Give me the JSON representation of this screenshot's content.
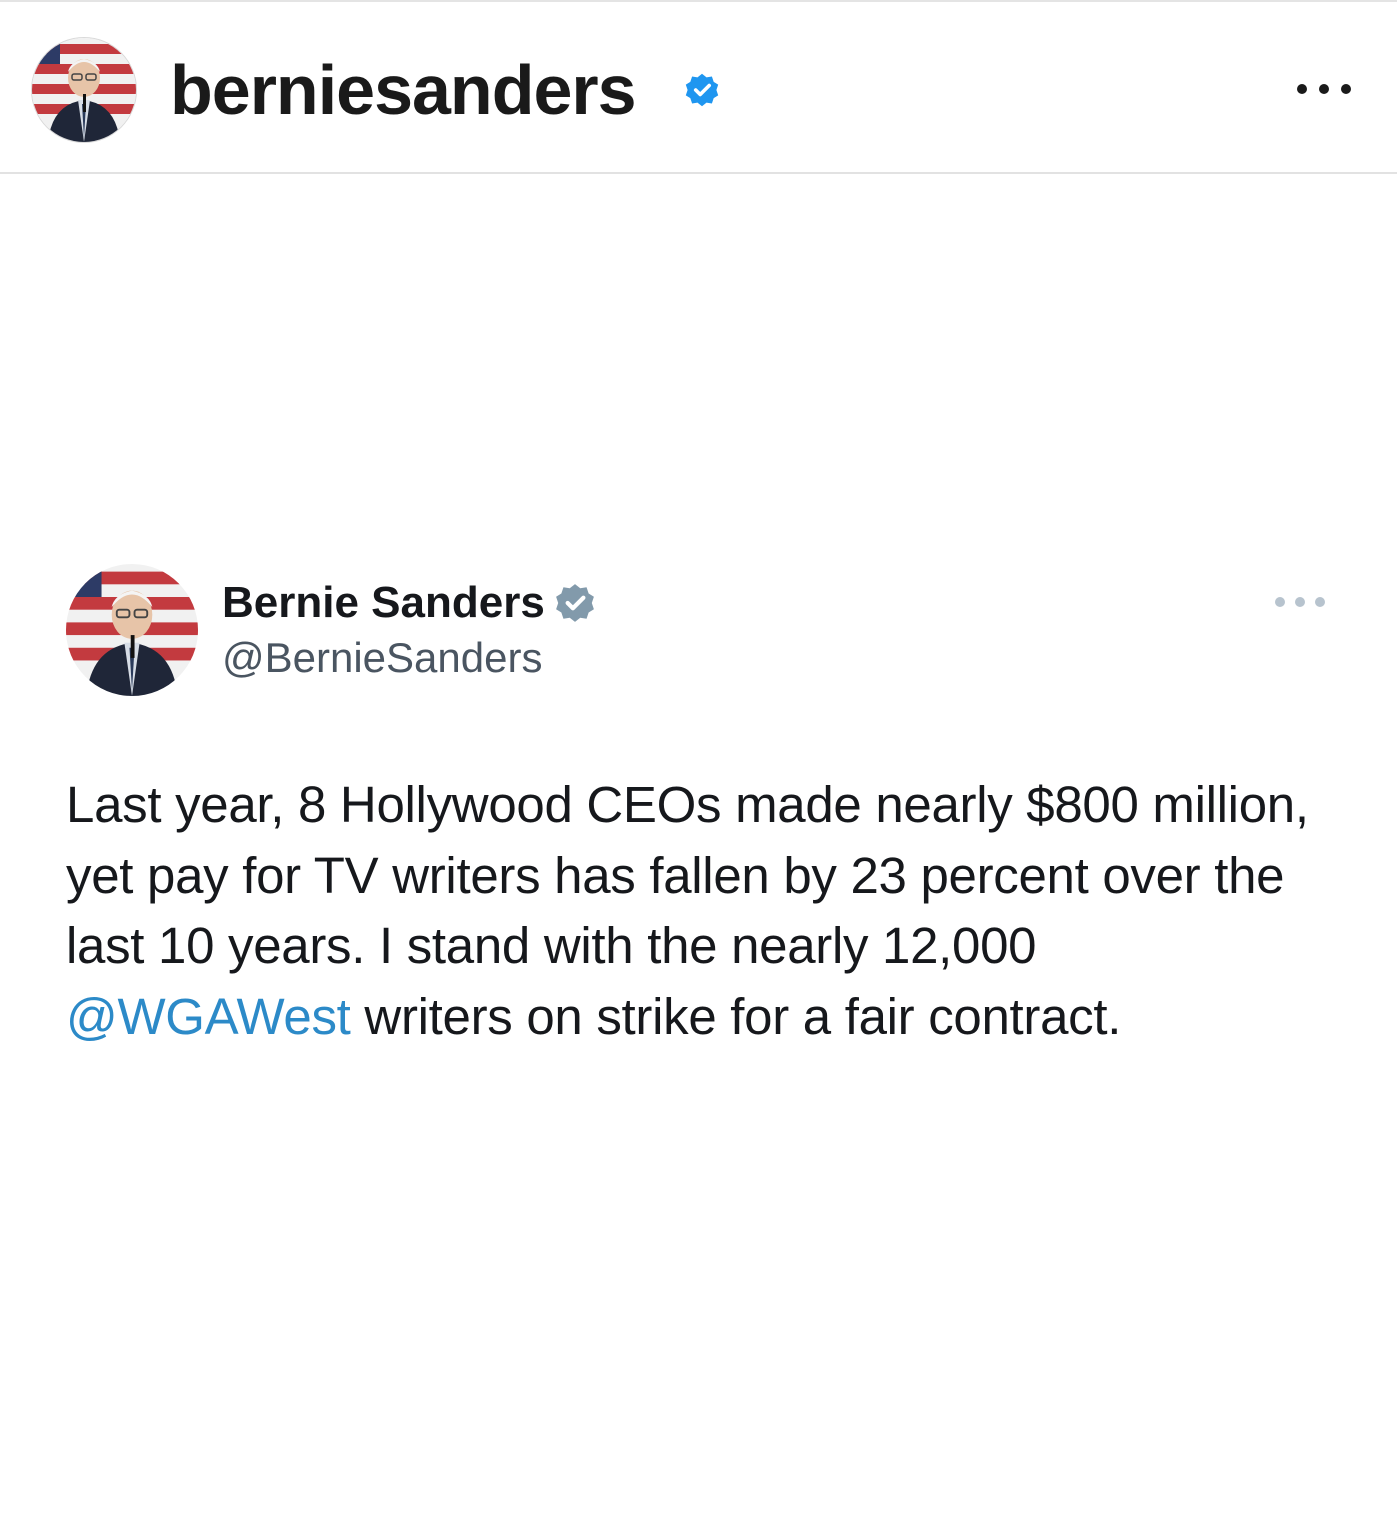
{
  "instagram": {
    "username": "berniesanders",
    "verified_icon": "verified-badge-icon",
    "more_icon": "more-horizontal-icon",
    "accent_color": "#1f96f0"
  },
  "tweet": {
    "display_name": "Bernie Sanders",
    "handle": "@BernieSanders",
    "verified_icon": "verified-badge-icon",
    "more_icon": "more-horizontal-icon",
    "text": {
      "line1": "Last year, 8 Hollywood CEOs made nearly $800 million,",
      "line2": "yet pay for TV writers has fallen by 23 percent over the",
      "line3": "last 10 years. I stand with the nearly 12,000",
      "mention": "@WGAWest",
      "line4_rest": " writers on strike for a fair contract."
    },
    "link_color": "#2c8ac8"
  }
}
